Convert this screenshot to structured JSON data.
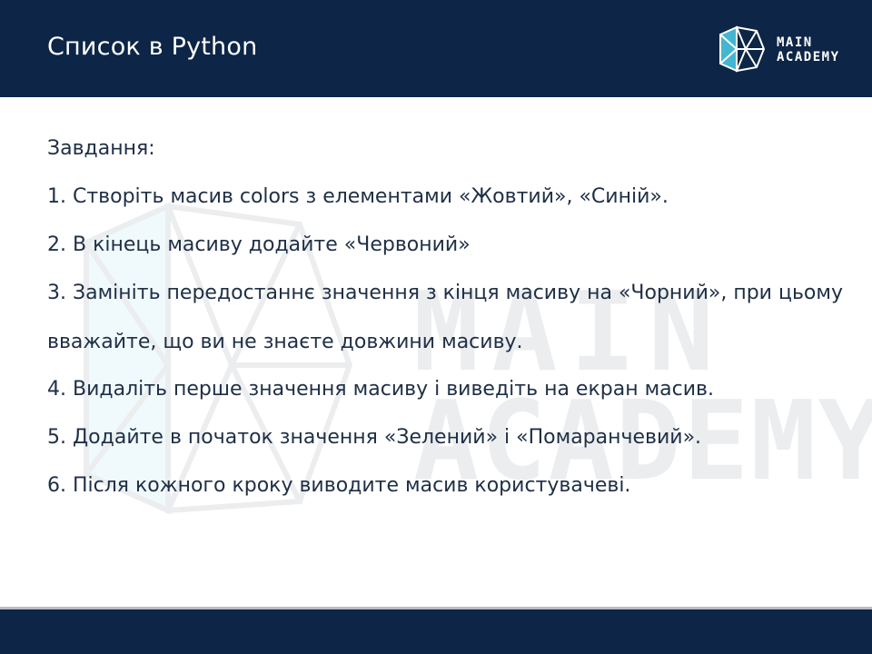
{
  "slide": {
    "title": "Список в Python"
  },
  "logo": {
    "line1": "MAIN",
    "line2": "ACADEMY",
    "icon": "main-academy-logo-icon",
    "watermark_line1": "MAIN",
    "watermark_line2": "ACADEMY"
  },
  "tasks": {
    "heading": "Завдання:",
    "items": [
      "1. Створіть масив colors з елементами «Жовтий», «Синій».",
      "2. В кінець масиву додайте «Червоний»",
      "3. Замініть передостаннє значення з кінця масиву на «Чорний», при цьому вважайте, що ви не знаєте довжини масиву.",
      "4. Видаліть перше значення масиву і виведіть на екран масив.",
      "5. Додайте в початок значення «Зелений» і «Помаранчевий».",
      "6. Після кожного кроку виводите масив користувачеві."
    ]
  },
  "colors": {
    "header_bg": "#0d2546",
    "text": "#1f2f46",
    "accent_cyan": "#4fd0ea",
    "watermark": "#c8ccd2"
  }
}
